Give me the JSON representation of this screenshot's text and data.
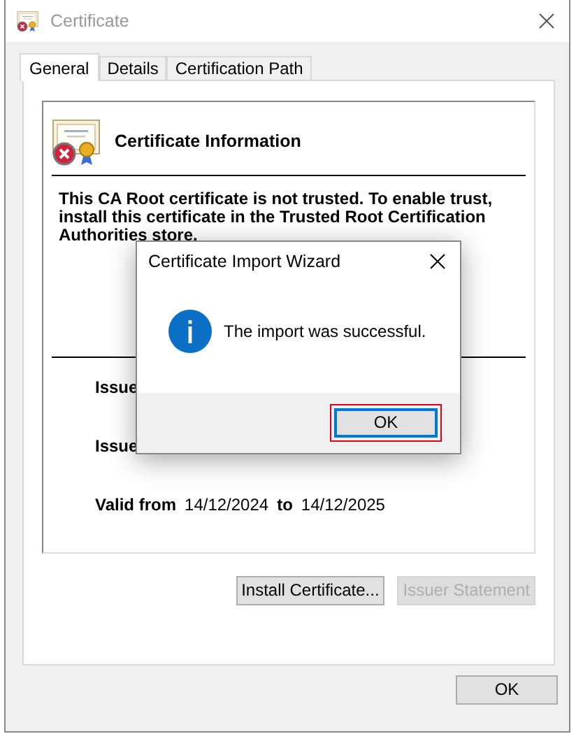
{
  "window": {
    "title": "Certificate",
    "active": false
  },
  "tabs": [
    {
      "label": "General",
      "selected": true
    },
    {
      "label": "Details",
      "selected": false
    },
    {
      "label": "Certification Path",
      "selected": false
    }
  ],
  "info": {
    "heading": "Certificate Information",
    "trusted": false,
    "message": "This CA Root certificate is not trusted. To enable trust, install this certificate in the Trusted Root Certification Authorities store."
  },
  "fields": [
    {
      "label": "Issue"
    },
    {
      "label": "Issue"
    }
  ],
  "validity": {
    "from_label": "Valid from",
    "from": "14/12/2024",
    "to_label": "to",
    "to": "14/12/2025"
  },
  "buttons": [
    {
      "label": "Install Certificate...",
      "disabled": false
    },
    {
      "label": "Issuer Statement",
      "disabled": true
    }
  ],
  "footer_button": {
    "label": "OK"
  },
  "dialog": {
    "title": "Certificate Import Wizard",
    "message": "The import was successful.",
    "button": {
      "label": "OK",
      "focused": true,
      "highlighted": true
    }
  }
}
